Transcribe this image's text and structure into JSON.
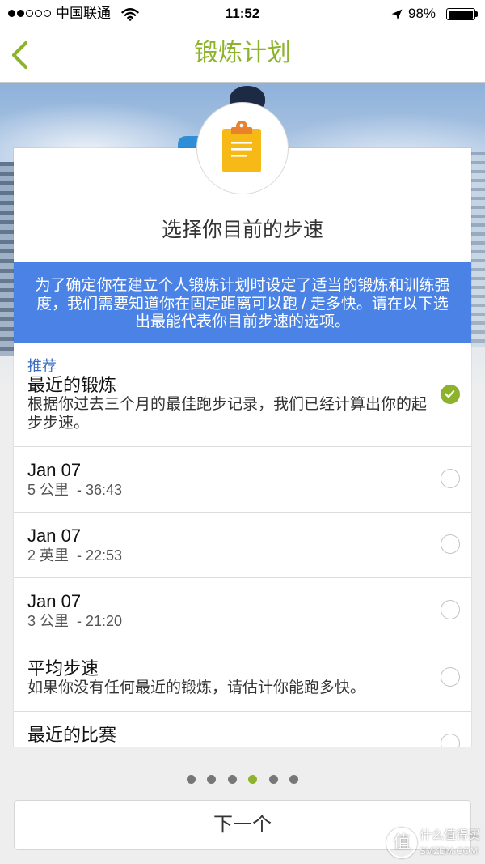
{
  "status_bar": {
    "signal": {
      "filled": 2,
      "total": 5
    },
    "carrier": "中国联通",
    "wifi_icon": "wifi-icon",
    "time": "11:52",
    "location_icon": "location-arrow-icon",
    "battery_text": "98%",
    "battery_level": 0.98
  },
  "nav": {
    "back_icon": "chevron-left-icon",
    "title": "锻炼计划"
  },
  "colors": {
    "accent": "#8db32d",
    "banner": "#4a83e5",
    "recommended_tag": "#3a6cc2",
    "clipboard": "#f7b916",
    "clipboard_clip": "#e9812d"
  },
  "card": {
    "icon": "clipboard-icon",
    "title": "选择你目前的步速",
    "banner_lines": [
      "为了确定你在建立个人锻炼计划时设定了适当的锻炼和训练强",
      "度，我们需要知道你在固定距离可以跑 / 走多快。请在以下选",
      "出最能代表你目前步速的选项。"
    ]
  },
  "options": [
    {
      "tag": "推荐",
      "title": "最近的锻炼",
      "desc_lines": [
        "根据你过去三个月的最佳跑步记录，我们已经计算出你的起",
        "步步速。"
      ],
      "selected": true
    },
    {
      "title": "Jan 07",
      "detail": "5 公里  - 36:43",
      "selected": false
    },
    {
      "title": "Jan 07",
      "detail": "2 英里  - 22:53",
      "selected": false
    },
    {
      "title": "Jan 07",
      "detail": "3 公里  - 21:20",
      "selected": false
    },
    {
      "title": "平均步速",
      "desc_lines": [
        "如果你没有任何最近的锻炼，请估计你能跑多快。"
      ],
      "selected": false
    },
    {
      "title": "最近的比赛",
      "selected": false
    }
  ],
  "pager": {
    "count": 6,
    "active_index": 3
  },
  "next_button": {
    "label": "下一个"
  },
  "watermark": {
    "badge": "值",
    "name": "什么值得买",
    "domain": "SMZDM.COM"
  }
}
